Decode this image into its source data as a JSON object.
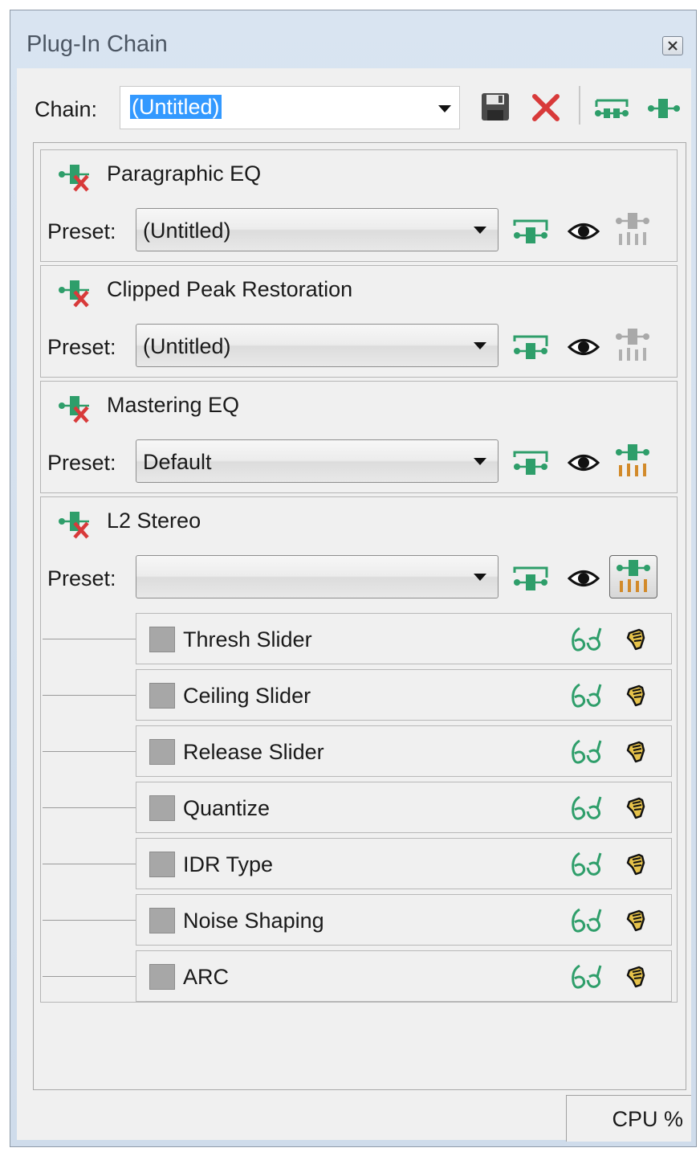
{
  "window": {
    "title": "Plug-In Chain"
  },
  "chain": {
    "label": "Chain:",
    "value": "(Untitled)"
  },
  "plugins": [
    {
      "name": "Paragraphic EQ",
      "preset_label": "Preset:",
      "preset": "(Untitled)",
      "settings_enabled": false
    },
    {
      "name": "Clipped Peak Restoration",
      "preset_label": "Preset:",
      "preset": "(Untitled)",
      "settings_enabled": false
    },
    {
      "name": "Mastering EQ",
      "preset_label": "Preset:",
      "preset": "Default",
      "settings_enabled": true
    },
    {
      "name": "L2 Stereo",
      "preset_label": "Preset:",
      "preset": "",
      "settings_enabled": true,
      "settings_active": true
    }
  ],
  "parameters": [
    {
      "name": "Thresh Slider"
    },
    {
      "name": "Ceiling Slider"
    },
    {
      "name": "Release Slider"
    },
    {
      "name": "Quantize"
    },
    {
      "name": "IDR Type"
    },
    {
      "name": "Noise Shaping"
    },
    {
      "name": "ARC"
    }
  ],
  "status": {
    "cpu": "CPU %"
  },
  "colors": {
    "accent_green": "#2e9e6a",
    "delete_red": "#d83a3a",
    "selection_blue": "#3399ff"
  },
  "icons": [
    "close-icon",
    "save-icon",
    "delete-icon",
    "chain-add-icon",
    "plugin-add-icon",
    "plugin-bypass-icon",
    "envelope-icon",
    "eye-icon",
    "settings-icon",
    "automation-icon",
    "hand-icon"
  ]
}
